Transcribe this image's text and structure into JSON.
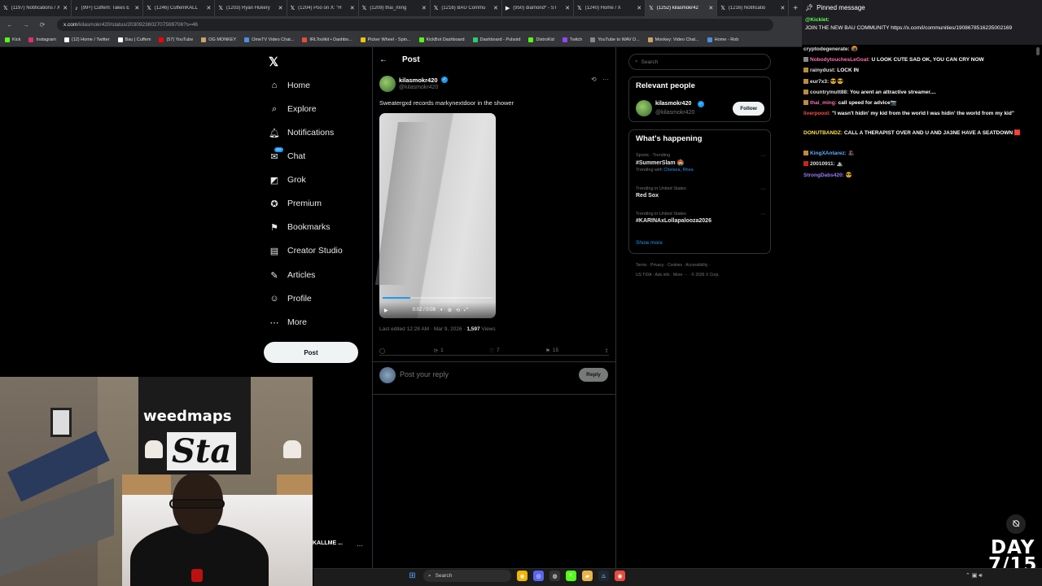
{
  "browser": {
    "tabs": [
      {
        "icon": "x-icon",
        "glyph": "𝕏",
        "title": "(1197) Notifications / X"
      },
      {
        "icon": "tiktok-icon",
        "glyph": "♪",
        "title": "(99+) Cuffem: Takes E"
      },
      {
        "icon": "x-icon",
        "glyph": "𝕏",
        "title": "(1246) CuffemKALL"
      },
      {
        "icon": "x-icon",
        "glyph": "𝕏",
        "title": "(1203) Ryan Hukery"
      },
      {
        "icon": "x-icon",
        "glyph": "𝕏",
        "title": "(1204) Poo on X: \"H"
      },
      {
        "icon": "x-icon",
        "glyph": "𝕏",
        "title": "(1209) thai_ming"
      },
      {
        "icon": "x-icon",
        "glyph": "𝕏",
        "title": "(1216) BAU Commu"
      },
      {
        "icon": "youtube-icon",
        "glyph": "▶",
        "title": "(950) diamond* - ST"
      },
      {
        "icon": "x-icon",
        "glyph": "𝕏",
        "title": "(1240) Home / X"
      },
      {
        "icon": "x-icon",
        "glyph": "𝕏",
        "title": "(1252) kilasmokr42"
      },
      {
        "icon": "x-icon",
        "glyph": "𝕏",
        "title": "(1216) Notificatio"
      }
    ],
    "close_glyph": "✕",
    "new_tab_glyph": "+",
    "url_host": "x.com",
    "url_path": "/kilasmokr420/status/2030923602707599706?s=46",
    "nav_back": "←",
    "nav_forward": "→",
    "nav_reload": "⟳",
    "bookmarks": [
      {
        "label": "Kick",
        "color": "#53fc18"
      },
      {
        "label": "Instagram",
        "color": "#e1306c"
      },
      {
        "label": "(12) Home / Twitter",
        "color": "#ffffff"
      },
      {
        "label": "Bau | Cuffem",
        "color": "#ffffff"
      },
      {
        "label": "(57) YouTube",
        "color": "#ff0000"
      },
      {
        "label": "OG MONKEY",
        "color": "#c9a36b"
      },
      {
        "label": "OmeTV Video Chat...",
        "color": "#4a90e2"
      },
      {
        "label": "IRLToolkit • Dashbo...",
        "color": "#e74c3c"
      },
      {
        "label": "Picker Wheel - Spin...",
        "color": "#f1c40f"
      },
      {
        "label": "KickBot Dashboard",
        "color": "#53fc18"
      },
      {
        "label": "Dashboard - Pulsoid",
        "color": "#2ecc71"
      },
      {
        "label": "DistroKid",
        "color": "#53fc18"
      },
      {
        "label": "Twitch",
        "color": "#9146ff"
      },
      {
        "label": "YouTube to WAV D...",
        "color": "#888888"
      },
      {
        "label": "Monkey: Video Chat...",
        "color": "#c9a36b"
      },
      {
        "label": "Home - Rob",
        "color": "#4a90e2"
      }
    ]
  },
  "nav": {
    "logo": "𝕏",
    "items": [
      {
        "label": "Home",
        "glyph": "⌂"
      },
      {
        "label": "Explore",
        "glyph": "⌕"
      },
      {
        "label": "Notifications",
        "glyph": "🔔︎",
        "badge": ""
      },
      {
        "label": "Chat",
        "glyph": "✉",
        "badge": "20+"
      },
      {
        "label": "Grok",
        "glyph": "◩"
      },
      {
        "label": "Premium",
        "glyph": "✪"
      },
      {
        "label": "Bookmarks",
        "glyph": "⚑"
      },
      {
        "label": "Creator Studio",
        "glyph": "▤"
      },
      {
        "label": "Articles",
        "glyph": "✎"
      },
      {
        "label": "Profile",
        "glyph": "☺"
      },
      {
        "label": "More",
        "glyph": "⋯"
      }
    ],
    "post_button": "Post",
    "account_name": "KALLME ...",
    "account_more": "···"
  },
  "post": {
    "header_title": "Post",
    "back_glyph": "←",
    "author_name": "kilasmokr420",
    "author_handle": "@kilasmokr420",
    "verified_glyph": "✓",
    "grok_glyph": "⟲",
    "more_glyph": "···",
    "text": "Sweatergxd records markynextdoor in the shower",
    "video": {
      "play_glyph": "▶",
      "time": "0:02 / 0:08",
      "progress": 0.25,
      "volume_glyph": "🔈︎",
      "settings_glyph": "⚙",
      "loop_glyph": "⟲",
      "fullscreen_glyph": "⤢"
    },
    "meta_prefix": "Last edited 12:28 AM · Mar 9, 2026 · ",
    "views_count": "1,597",
    "views_label": "Views",
    "actions": {
      "reply_glyph": "◯",
      "reply_count": "",
      "repost_glyph": "⟳",
      "repost_count": "1",
      "like_glyph": "♡",
      "like_count": "7",
      "bookmark_glyph": "⚑",
      "bookmark_count": "15",
      "share_glyph": "⇪"
    },
    "reply_placeholder": "Post your reply",
    "reply_button": "Reply"
  },
  "sidebar": {
    "search_placeholder": "Search",
    "search_glyph": "⌕",
    "relevant_title": "Relevant people",
    "relevant_name": "kilasmokr420",
    "relevant_handle": "@kilasmokr420",
    "follow_button": "Follow",
    "happening_title": "What's happening",
    "trends": [
      {
        "context": "Sports · Trending",
        "name": "#SummerSlam 🏟️",
        "sub_prefix": "Trending with ",
        "sub_link": "Chelsea, Rhea"
      },
      {
        "context": "Trending in United States",
        "name": "Red Sox",
        "sub_prefix": "",
        "sub_link": ""
      },
      {
        "context": "Trending in United States",
        "name": "#KARINAxLollapalooza2026",
        "sub_prefix": "",
        "sub_link": ""
      }
    ],
    "trend_more_glyph": "···",
    "show_more": "Show more",
    "footer_line1": "Terms  ·  Privacy  ·  Cookies  ·  Accessibility  ·",
    "footer_line2": "US TIDA  ·  Ads info  ·  More ···  ·  © 2026 X Corp."
  },
  "chat": {
    "pinned_header": "Pinned message",
    "pin_glyph": "📌︎",
    "pinned_user": "@Kicklet:",
    "pinned_text": "JOIN THE NEW BAU COMMUNITY https://x.com/i/communities/1908678516235002169",
    "messages": [
      {
        "user": "cryptodegenerate:",
        "text": " 🍘",
        "color": "#e0e0e0",
        "badge": ""
      },
      {
        "user": "NobodytouchesLeGoat:",
        "text": " U LOOK CUTE SAD OK, YOU CAN CRY NOW",
        "color": "#ff6fb5",
        "badge": "#888888"
      },
      {
        "user": "rainydust:",
        "text": " LOCK IN",
        "color": "#e0e0e0",
        "badge": "#c08a3e"
      },
      {
        "user": "eur7x3:",
        "text": " 😎😎",
        "color": "#e0e0e0",
        "badge": "#c08a3e"
      },
      {
        "user": "countrymutt88:",
        "text": " You arent an attractive streamer....",
        "color": "#e0e0e0",
        "badge": "#c08a3e"
      },
      {
        "user": "thai_ming:",
        "text": " call speed for advice📷",
        "color": "#ff6fb5",
        "badge": "#c08a3e"
      },
      {
        "user": "liverpoool:",
        "text": " \"I wasn't hidin' my kid from the world I was hidin' the world from my kid\"",
        "color": "#ff4d4d",
        "badge": ""
      },
      {
        "user": "DONUTBANDZ:",
        "text": " CALL A THERAPIST OVER AND U AND JA3NE HAVE A SEATDOWN 🟥",
        "color": "#ffe14d",
        "badge": ""
      },
      {
        "user": "KingXAntarez:",
        "text": " 🎩",
        "color": "#5ab0ff",
        "badge": "#c08a3e"
      },
      {
        "user": "20010911:",
        "text": " ⛰️",
        "color": "#e0e0e0",
        "badge": "#cc2222"
      },
      {
        "user": "StrongDabs420:",
        "text": " 😎",
        "color": "#9b7bff",
        "badge": ""
      }
    ],
    "kick_glyph": "⦰",
    "day_line1": "DAY",
    "day_line2": "7/15"
  },
  "taskbar": {
    "start_glyph": "⊞",
    "search_label": "Search",
    "search_glyph": "⌕",
    "apps": [
      {
        "name": "chrome-icon",
        "glyph": "◉",
        "color": "#f4b400"
      },
      {
        "name": "discord-icon",
        "glyph": "◎",
        "color": "#5865f2"
      },
      {
        "name": "obs-icon",
        "glyph": "◍",
        "color": "#333333"
      },
      {
        "name": "kick-app-icon",
        "glyph": "K",
        "color": "#53fc18"
      },
      {
        "name": "folder-icon",
        "glyph": "▰",
        "color": "#e8b54a"
      },
      {
        "name": "steam-icon",
        "glyph": "♨",
        "color": "#1b2838"
      },
      {
        "name": "browser-icon",
        "glyph": "◉",
        "color": "#e74c3c"
      }
    ],
    "tray": "⌃  ▣  🔊︎"
  }
}
